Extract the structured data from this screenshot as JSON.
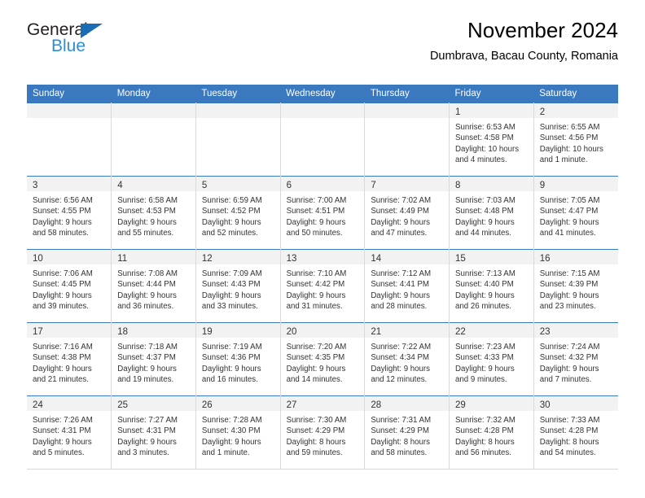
{
  "brand": {
    "word_one": "General",
    "word_two": "Blue",
    "triangle_icon": "blue-triangle-icon",
    "color_dark": "#231f20",
    "color_blue": "#2b8fd6",
    "color_triangle": "#1b6cb5"
  },
  "header": {
    "title": "November 2024",
    "location": "Dumbrava, Bacau County, Romania"
  },
  "theme": {
    "header_row_bg": "#3a78bf",
    "header_row_text": "#ffffff",
    "daynum_strip_bg": "#f2f2f2",
    "cell_border": "#d9d9d9",
    "body_text": "#333333"
  },
  "weekdays": [
    "Sunday",
    "Monday",
    "Tuesday",
    "Wednesday",
    "Thursday",
    "Friday",
    "Saturday"
  ],
  "weeks": [
    [
      {
        "day": "",
        "lines": []
      },
      {
        "day": "",
        "lines": []
      },
      {
        "day": "",
        "lines": []
      },
      {
        "day": "",
        "lines": []
      },
      {
        "day": "",
        "lines": []
      },
      {
        "day": "1",
        "lines": [
          "Sunrise: 6:53 AM",
          "Sunset: 4:58 PM",
          "Daylight: 10 hours",
          "and 4 minutes."
        ]
      },
      {
        "day": "2",
        "lines": [
          "Sunrise: 6:55 AM",
          "Sunset: 4:56 PM",
          "Daylight: 10 hours",
          "and 1 minute."
        ]
      }
    ],
    [
      {
        "day": "3",
        "lines": [
          "Sunrise: 6:56 AM",
          "Sunset: 4:55 PM",
          "Daylight: 9 hours",
          "and 58 minutes."
        ]
      },
      {
        "day": "4",
        "lines": [
          "Sunrise: 6:58 AM",
          "Sunset: 4:53 PM",
          "Daylight: 9 hours",
          "and 55 minutes."
        ]
      },
      {
        "day": "5",
        "lines": [
          "Sunrise: 6:59 AM",
          "Sunset: 4:52 PM",
          "Daylight: 9 hours",
          "and 52 minutes."
        ]
      },
      {
        "day": "6",
        "lines": [
          "Sunrise: 7:00 AM",
          "Sunset: 4:51 PM",
          "Daylight: 9 hours",
          "and 50 minutes."
        ]
      },
      {
        "day": "7",
        "lines": [
          "Sunrise: 7:02 AM",
          "Sunset: 4:49 PM",
          "Daylight: 9 hours",
          "and 47 minutes."
        ]
      },
      {
        "day": "8",
        "lines": [
          "Sunrise: 7:03 AM",
          "Sunset: 4:48 PM",
          "Daylight: 9 hours",
          "and 44 minutes."
        ]
      },
      {
        "day": "9",
        "lines": [
          "Sunrise: 7:05 AM",
          "Sunset: 4:47 PM",
          "Daylight: 9 hours",
          "and 41 minutes."
        ]
      }
    ],
    [
      {
        "day": "10",
        "lines": [
          "Sunrise: 7:06 AM",
          "Sunset: 4:45 PM",
          "Daylight: 9 hours",
          "and 39 minutes."
        ]
      },
      {
        "day": "11",
        "lines": [
          "Sunrise: 7:08 AM",
          "Sunset: 4:44 PM",
          "Daylight: 9 hours",
          "and 36 minutes."
        ]
      },
      {
        "day": "12",
        "lines": [
          "Sunrise: 7:09 AM",
          "Sunset: 4:43 PM",
          "Daylight: 9 hours",
          "and 33 minutes."
        ]
      },
      {
        "day": "13",
        "lines": [
          "Sunrise: 7:10 AM",
          "Sunset: 4:42 PM",
          "Daylight: 9 hours",
          "and 31 minutes."
        ]
      },
      {
        "day": "14",
        "lines": [
          "Sunrise: 7:12 AM",
          "Sunset: 4:41 PM",
          "Daylight: 9 hours",
          "and 28 minutes."
        ]
      },
      {
        "day": "15",
        "lines": [
          "Sunrise: 7:13 AM",
          "Sunset: 4:40 PM",
          "Daylight: 9 hours",
          "and 26 minutes."
        ]
      },
      {
        "day": "16",
        "lines": [
          "Sunrise: 7:15 AM",
          "Sunset: 4:39 PM",
          "Daylight: 9 hours",
          "and 23 minutes."
        ]
      }
    ],
    [
      {
        "day": "17",
        "lines": [
          "Sunrise: 7:16 AM",
          "Sunset: 4:38 PM",
          "Daylight: 9 hours",
          "and 21 minutes."
        ]
      },
      {
        "day": "18",
        "lines": [
          "Sunrise: 7:18 AM",
          "Sunset: 4:37 PM",
          "Daylight: 9 hours",
          "and 19 minutes."
        ]
      },
      {
        "day": "19",
        "lines": [
          "Sunrise: 7:19 AM",
          "Sunset: 4:36 PM",
          "Daylight: 9 hours",
          "and 16 minutes."
        ]
      },
      {
        "day": "20",
        "lines": [
          "Sunrise: 7:20 AM",
          "Sunset: 4:35 PM",
          "Daylight: 9 hours",
          "and 14 minutes."
        ]
      },
      {
        "day": "21",
        "lines": [
          "Sunrise: 7:22 AM",
          "Sunset: 4:34 PM",
          "Daylight: 9 hours",
          "and 12 minutes."
        ]
      },
      {
        "day": "22",
        "lines": [
          "Sunrise: 7:23 AM",
          "Sunset: 4:33 PM",
          "Daylight: 9 hours",
          "and 9 minutes."
        ]
      },
      {
        "day": "23",
        "lines": [
          "Sunrise: 7:24 AM",
          "Sunset: 4:32 PM",
          "Daylight: 9 hours",
          "and 7 minutes."
        ]
      }
    ],
    [
      {
        "day": "24",
        "lines": [
          "Sunrise: 7:26 AM",
          "Sunset: 4:31 PM",
          "Daylight: 9 hours",
          "and 5 minutes."
        ]
      },
      {
        "day": "25",
        "lines": [
          "Sunrise: 7:27 AM",
          "Sunset: 4:31 PM",
          "Daylight: 9 hours",
          "and 3 minutes."
        ]
      },
      {
        "day": "26",
        "lines": [
          "Sunrise: 7:28 AM",
          "Sunset: 4:30 PM",
          "Daylight: 9 hours",
          "and 1 minute."
        ]
      },
      {
        "day": "27",
        "lines": [
          "Sunrise: 7:30 AM",
          "Sunset: 4:29 PM",
          "Daylight: 8 hours",
          "and 59 minutes."
        ]
      },
      {
        "day": "28",
        "lines": [
          "Sunrise: 7:31 AM",
          "Sunset: 4:29 PM",
          "Daylight: 8 hours",
          "and 58 minutes."
        ]
      },
      {
        "day": "29",
        "lines": [
          "Sunrise: 7:32 AM",
          "Sunset: 4:28 PM",
          "Daylight: 8 hours",
          "and 56 minutes."
        ]
      },
      {
        "day": "30",
        "lines": [
          "Sunrise: 7:33 AM",
          "Sunset: 4:28 PM",
          "Daylight: 8 hours",
          "and 54 minutes."
        ]
      }
    ]
  ]
}
